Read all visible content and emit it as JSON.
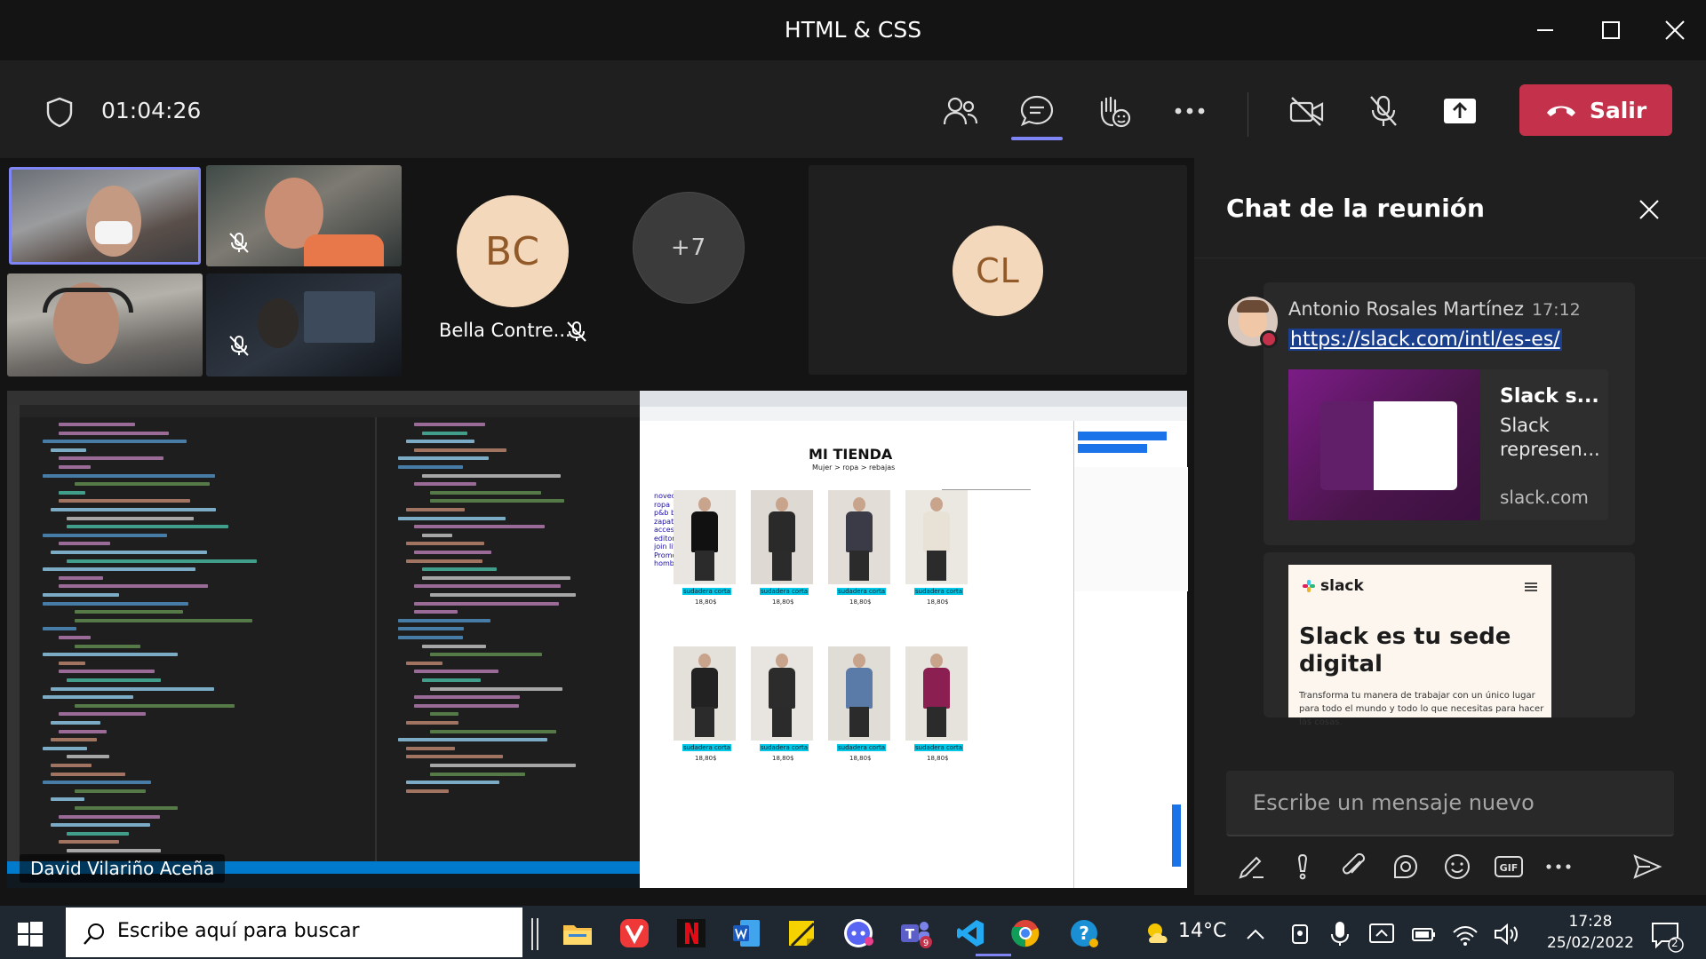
{
  "window": {
    "title": "HTML & CSS"
  },
  "toolbar": {
    "timer": "01:04:26",
    "leave_label": "Salir"
  },
  "participants": {
    "bc_initials": "BC",
    "bc_name": "Bella Contre...",
    "overflow": "+7",
    "cl_initials": "CL"
  },
  "share": {
    "presenter": "David Vilariño Aceña",
    "browser_heading": "MI TIENDA",
    "browser_sub": "Mujer > ropa > rebajas",
    "products": [
      {
        "name": "sudadera corta",
        "price": "18,80$"
      },
      {
        "name": "sudadera corta",
        "price": "18,80$"
      },
      {
        "name": "sudadera corta",
        "price": "18,80$"
      },
      {
        "name": "sudadera corta",
        "price": "18,80$"
      },
      {
        "name": "sudadera corta",
        "price": "18,80$"
      },
      {
        "name": "sudadera corta",
        "price": "18,80$"
      },
      {
        "name": "sudadera corta",
        "price": "18,80$"
      },
      {
        "name": "sudadera corta",
        "price": "18,80$"
      }
    ],
    "menu": [
      "novedades",
      "ropa",
      "p&b by rosalia",
      "zapatos",
      "accesorios",
      "editorials",
      "join life",
      "Promociones",
      "hombre/mujer"
    ]
  },
  "chat": {
    "title": "Chat de la reunión",
    "sender": "Antonio Rosales Martínez",
    "time": "17:12",
    "link": "https://slack.com/intl/es-es/",
    "preview_title": "Slack s...",
    "preview_desc": "Slack represen...",
    "preview_domain": "slack.com",
    "preview2_logo": "slack",
    "preview2_head": "Slack es tu sede digital",
    "preview2_sub": "Transforma tu manera de trabajar con un único lugar para todo el mundo y todo lo que necesitas para hacer las cosas.",
    "compose_placeholder": "Escribe un mensaje nuevo"
  },
  "taskbar": {
    "search_placeholder": "Escribe aquí para buscar",
    "weather": "14°C",
    "time": "17:28",
    "date": "25/02/2022",
    "notifications": "2"
  },
  "colors": {
    "accent": "#7f85f5",
    "leave": "#c4314b",
    "avatar_bg": "#f3d8bc",
    "avatar_fg": "#915a28"
  }
}
